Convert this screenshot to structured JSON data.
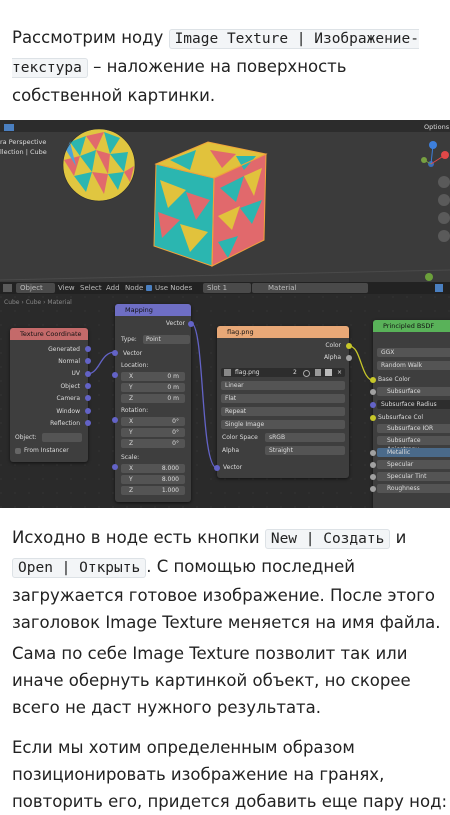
{
  "intro": {
    "t1": "Рассмотрим ноду ",
    "code1": "Image Texture | Изображение-текстура",
    "t2": " – наложение на поверхность собственной картинки."
  },
  "viewport": {
    "camera_label_1": "ra Perspective",
    "camera_label_2": "llection | Cube",
    "options_label": "Options"
  },
  "node_editor": {
    "toolbar": {
      "object_menu": "Object",
      "view": "View",
      "select": "Select",
      "add": "Add",
      "node": "Node",
      "use_nodes": "Use Nodes",
      "slot": "Slot 1",
      "material": "Material"
    },
    "breadcrumb": "Cube  ›  Cube  ›  Material",
    "texture_coordinate": {
      "title": "Texture Coordinate",
      "outputs": [
        "Generated",
        "Normal",
        "UV",
        "Object",
        "Camera",
        "Window",
        "Reflection"
      ],
      "object_label": "Object:",
      "from_instancer": "From Instancer"
    },
    "mapping": {
      "title": "Mapping",
      "vector_out": "Vector",
      "type_label": "Type:",
      "type_value": "Point",
      "vector_in": "Vector",
      "location_label": "Location:",
      "location": [
        {
          "axis": "X",
          "value": "0 m"
        },
        {
          "axis": "Y",
          "value": "0 m"
        },
        {
          "axis": "Z",
          "value": "0 m"
        }
      ],
      "rotation_label": "Rotation:",
      "rotation": [
        {
          "axis": "X",
          "value": "0°"
        },
        {
          "axis": "Y",
          "value": "0°"
        },
        {
          "axis": "Z",
          "value": "0°"
        }
      ],
      "scale_label": "Scale:",
      "scale": [
        {
          "axis": "X",
          "value": "8.000"
        },
        {
          "axis": "Y",
          "value": "8.000"
        },
        {
          "axis": "Z",
          "value": "1.000"
        }
      ]
    },
    "image_texture": {
      "title": "flag.png",
      "color_out": "Color",
      "alpha_out": "Alpha",
      "image_name": "flag.png",
      "users": "2",
      "interpolation": "Linear",
      "projection": "Flat",
      "extension": "Repeat",
      "source": "Single Image",
      "color_space_label": "Color Space",
      "color_space": "sRGB",
      "alpha_label": "Alpha",
      "alpha_value": "Straight",
      "vector_in": "Vector"
    },
    "bsdf": {
      "title": "Principled BSDF",
      "distribution": "GGX",
      "subsurface_method": "Random Walk",
      "inputs": [
        "Base Color",
        "Subsurface",
        "Subsurface Radius",
        "Subsurface Col",
        "Subsurface IOR",
        "Subsurface Anisotropy",
        "Metallic",
        "Specular",
        "Specular Tint",
        "Roughness"
      ]
    }
  },
  "body": {
    "p2_t1": "Исходно в ноде есть кнопки ",
    "p2_code1": "New | Создать",
    "p2_t2": " и ",
    "p2_code2": "Open | Открыть",
    "p2_t3": ". С помощью последней загружается готовое изображение. После этого заголовок Image Texture меняется на имя файла.",
    "p3": "Сама по себе Image Texture позволит так или иначе обернуть картинкой объект, но скорее всего не даст нужного результата.",
    "p4": "Если мы хотим определенным образом позиционировать изображение на гранях, повторить его, придется добавить еще пару нод:"
  },
  "colors": {
    "node_input_header": "#c46a6a",
    "node_vector_header": "#6e6ec4",
    "node_texture_header": "#e8a877",
    "node_shader_header": "#59b259",
    "socket_yellow": "#c7c729",
    "socket_purple": "#6363c7",
    "socket_gray": "#a1a1a1",
    "socket_green": "#63c763"
  }
}
